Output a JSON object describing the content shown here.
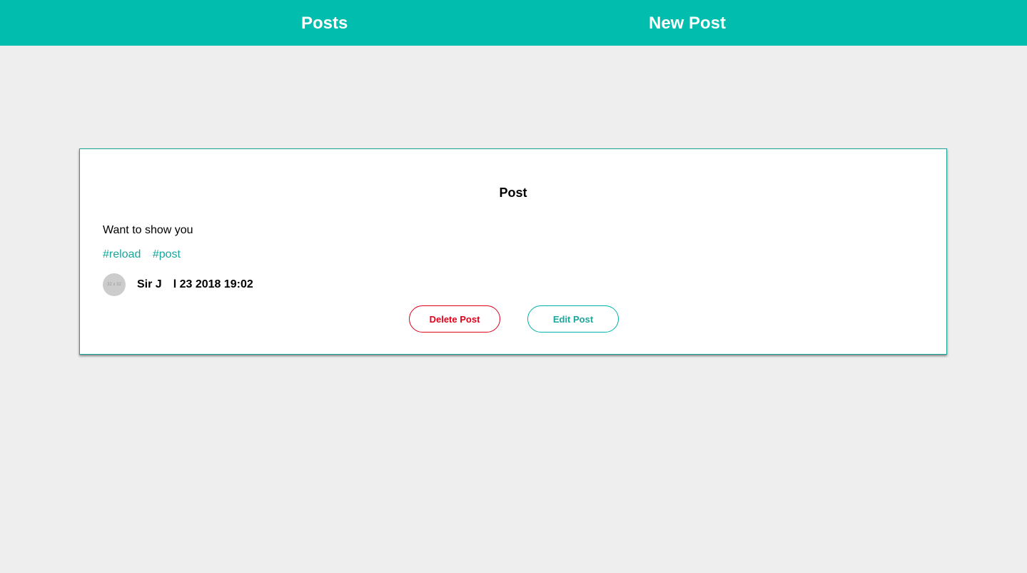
{
  "nav": {
    "posts_label": "Posts",
    "new_post_label": "New Post"
  },
  "post": {
    "title": "Post",
    "body": "Want to show you",
    "tags": [
      "#reload",
      "#post"
    ],
    "avatar_placeholder": "32 x 32",
    "author": "Sir J",
    "date": "l 23 2018 19:02",
    "delete_label": "Delete Post",
    "edit_label": "Edit Post"
  },
  "colors": {
    "header_bg": "#00bdae",
    "page_bg": "#eeeeee",
    "accent": "#1aa69b",
    "danger": "#e2001a"
  }
}
